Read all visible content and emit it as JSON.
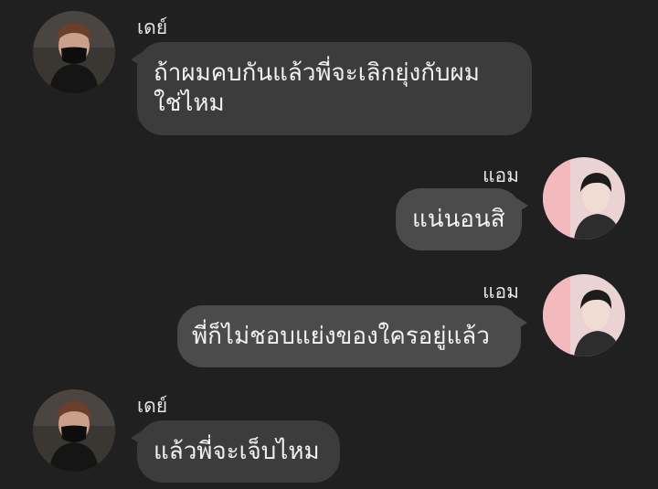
{
  "messages": [
    {
      "sender": "เดย์",
      "avatar_icon": "masked-boy-avatar-icon",
      "lines": [
        "ถ้าผมคบกันแล้วพี่จะเลิกยุ่งกับผม",
        "ใช่ไหม"
      ]
    },
    {
      "sender": "แอม",
      "avatar_icon": "pink-portrait-avatar-icon",
      "lines": [
        "แน่นอนสิ"
      ]
    },
    {
      "sender": "แอม",
      "avatar_icon": "pink-portrait-avatar-icon",
      "lines": [
        "พี่ก็ไม่ชอบแย่งของใครอยู่แล้ว"
      ]
    },
    {
      "sender": "เดย์",
      "avatar_icon": "masked-boy-avatar-icon",
      "lines": [
        "แล้วพี่จะเจ็บไหม"
      ]
    }
  ],
  "colors": {
    "background": "#202020",
    "bubble_left": "#3c3c3c",
    "bubble_right": "#4b4b4b",
    "text": "#f2f2f2"
  }
}
